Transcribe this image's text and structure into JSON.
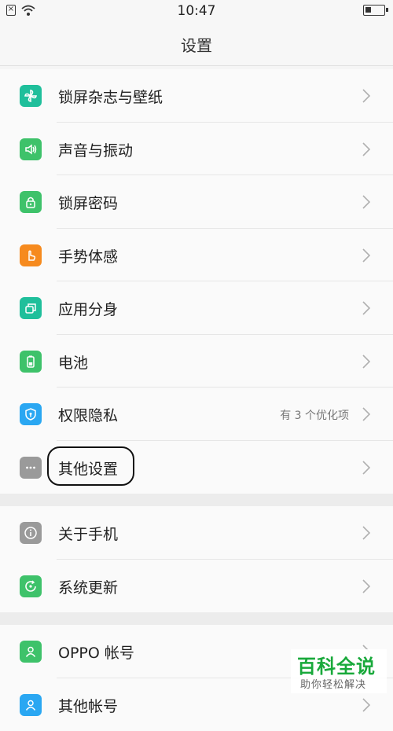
{
  "status_bar": {
    "time": "10:47"
  },
  "header": {
    "title": "设置"
  },
  "colors": {
    "teal": "#1fbf9b",
    "green": "#3ec26a",
    "orange": "#f68a1e",
    "blue": "#2aa7f2",
    "gray": "#9a9a9a"
  },
  "section1": {
    "items": [
      {
        "label": "锁屏杂志与壁纸",
        "icon": "pinwheel-icon",
        "hint": ""
      },
      {
        "label": "声音与振动",
        "icon": "speaker-icon",
        "hint": ""
      },
      {
        "label": "锁屏密码",
        "icon": "lock-icon",
        "hint": ""
      },
      {
        "label": "手势体感",
        "icon": "hand-icon",
        "hint": ""
      },
      {
        "label": "应用分身",
        "icon": "app-clone-icon",
        "hint": ""
      },
      {
        "label": "电池",
        "icon": "battery-icon",
        "hint": ""
      },
      {
        "label": "权限隐私",
        "icon": "shield-icon",
        "hint": "有 3 个优化项"
      },
      {
        "label": "其他设置",
        "icon": "more-icon",
        "hint": ""
      }
    ]
  },
  "section2": {
    "items": [
      {
        "label": "关于手机",
        "icon": "info-icon",
        "hint": ""
      },
      {
        "label": "系统更新",
        "icon": "update-icon",
        "hint": ""
      }
    ]
  },
  "section3": {
    "items": [
      {
        "label": "OPPO 帐号",
        "icon": "account-icon",
        "hint": ""
      },
      {
        "label": "其他帐号",
        "icon": "account-icon",
        "hint": ""
      }
    ]
  },
  "watermark": {
    "title": "百科全说",
    "subtitle": "助你轻松解决"
  }
}
